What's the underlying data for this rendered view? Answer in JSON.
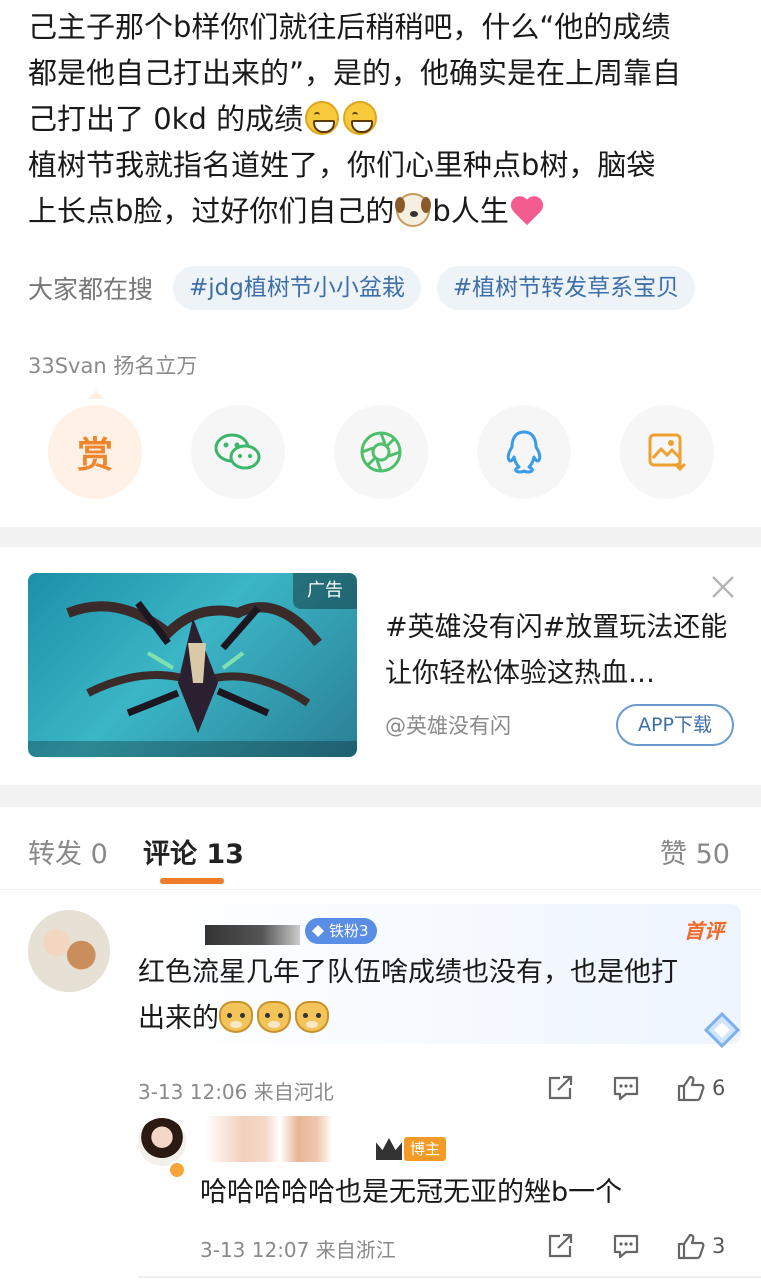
{
  "post": {
    "lines": [
      "己主子那个b样你们就往后稍稍吧，什么“他的成绩",
      "都是他自己打出来的”，是的，他确实是在上周靠自",
      "己打出了 0kd 的成绩",
      "植树节我就指名道姓了，你们心里种点b树，脑袋",
      "上长点b脸，过好你们自己的",
      "b人生"
    ]
  },
  "search": {
    "label": "大家都在搜",
    "tags": [
      "#jdg植树节小小盆栽",
      "#植树节转发草系宝贝"
    ]
  },
  "author_line": "33Svan 扬名立万",
  "share": {
    "reward_label": "赏",
    "icons": [
      "reward-icon",
      "wechat-icon",
      "moments-icon",
      "qq-icon",
      "save-image-icon"
    ]
  },
  "ad": {
    "badge": "广告",
    "title": "#英雄没有闪#放置玩法还能让你轻松体验这热血…",
    "source": "@英雄没有闪",
    "button": "APP下载"
  },
  "tabs": {
    "repost": "转发 0",
    "comments": "评论 13",
    "likes": "赞 50"
  },
  "comments": [
    {
      "fan_badge": "铁粉3",
      "top_label": "首评",
      "text_line1": "红色流星几年了队伍啥成绩也没有，也是他打",
      "text_line2": "出来的",
      "meta": "3-13 12:06  来自河北",
      "likes": "6"
    },
    {
      "badge": "博主",
      "text": "哈哈哈哈哈也是无冠无亚的矬b一个",
      "meta": "3-13 12:07  来自浙江",
      "likes": "3"
    }
  ],
  "colors": {
    "accent": "#f07c2a",
    "link": "#3f6fa8",
    "muted": "#8a8a8a"
  }
}
